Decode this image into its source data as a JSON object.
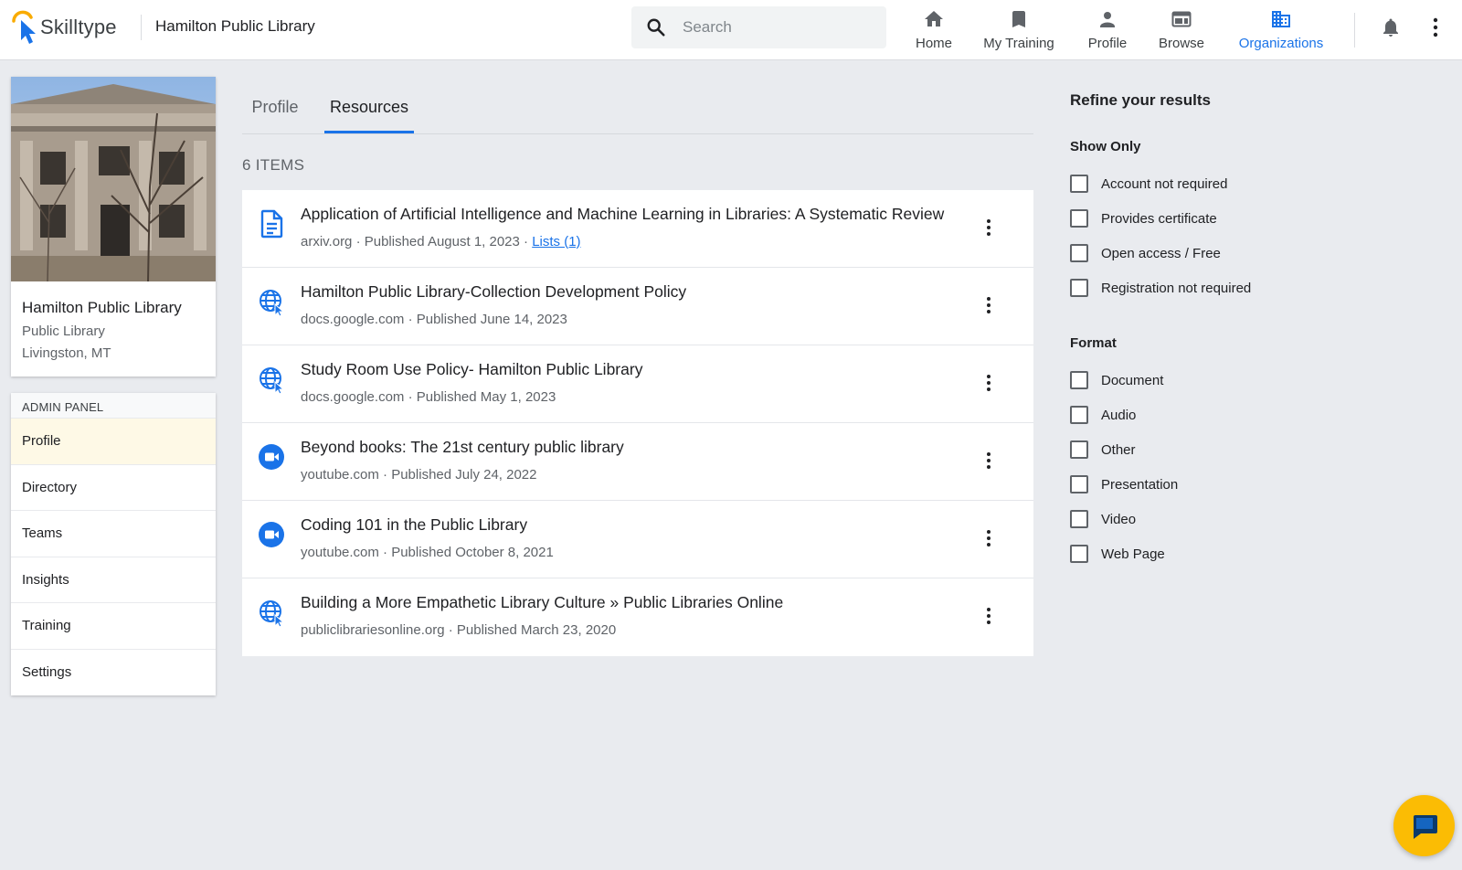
{
  "app": {
    "brand_name": "Skilltype",
    "org_title": "Hamilton Public Library"
  },
  "search": {
    "placeholder": "Search"
  },
  "nav": {
    "home": "Home",
    "my_training": "My Training",
    "profile": "Profile",
    "browse": "Browse",
    "organizations": "Organizations",
    "active": "Organizations"
  },
  "org_card": {
    "name": "Hamilton Public Library",
    "type": "Public Library",
    "location": "Livingston, MT"
  },
  "admin_panel": {
    "title": "ADMIN PANEL",
    "items": [
      "Profile",
      "Directory",
      "Teams",
      "Insights",
      "Training",
      "Settings"
    ],
    "selected": "Profile"
  },
  "tabs": {
    "profile": "Profile",
    "resources": "Resources",
    "active": "Resources"
  },
  "results": {
    "count_label": "6 ITEMS",
    "items": [
      {
        "icon": "document-icon",
        "title": "Application of Artificial Intelligence and Machine Learning in Libraries: A Systematic Review",
        "meta": "arxiv.org · Published August 1, 2023 · ",
        "lists_link": "Lists (1)"
      },
      {
        "icon": "web-page-icon",
        "title": "Hamilton Public Library-Collection Development Policy",
        "meta": "docs.google.com · Published June 14, 2023"
      },
      {
        "icon": "web-page-icon",
        "title": "Study Room Use Policy- Hamilton Public Library",
        "meta": "docs.google.com · Published May 1, 2023"
      },
      {
        "icon": "video-icon",
        "title": "Beyond books: The 21st century public library",
        "meta": "youtube.com · Published July 24, 2022"
      },
      {
        "icon": "video-icon",
        "title": "Coding 101 in the Public Library",
        "meta": "youtube.com · Published October 8, 2021"
      },
      {
        "icon": "web-page-icon",
        "title": "Building a More Empathetic Library Culture » Public Libraries Online",
        "meta": "publiclibrariesonline.org · Published March 23, 2020"
      }
    ]
  },
  "filters": {
    "title": "Refine your results",
    "show_only": {
      "heading": "Show Only",
      "options": [
        "Account not required",
        "Provides certificate",
        "Open access / Free",
        "Registration not required"
      ]
    },
    "format": {
      "heading": "Format",
      "options": [
        "Document",
        "Audio",
        "Other",
        "Presentation",
        "Video",
        "Web Page"
      ]
    }
  },
  "colors": {
    "accent": "#1a73e8",
    "selected_row": "#fef9e6",
    "chat_button": "#fbbc04",
    "page_bg": "#e9ebef"
  }
}
